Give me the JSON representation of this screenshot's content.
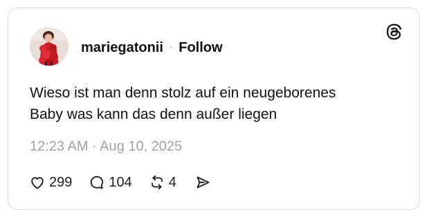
{
  "post": {
    "username": "mariegatonii",
    "separator": "·",
    "follow_label": "Follow",
    "text_lines": [
      "Wieso ist man denn stolz auf ein neugeborenes",
      "Baby was kann das denn außer liegen"
    ],
    "timestamp": "12:23 AM · Aug 10, 2025",
    "likes": "299",
    "replies": "104",
    "reposts": "4"
  },
  "icons": {
    "platform": "threads-logo-icon",
    "like": "heart-icon",
    "reply": "speech-bubble-icon",
    "repost": "repost-arrows-icon",
    "share": "send-paper-plane-icon"
  },
  "colors": {
    "text": "#111111",
    "muted": "#a3a3a3",
    "border": "#dcdcdc",
    "avatar_red": "#c8202a"
  }
}
